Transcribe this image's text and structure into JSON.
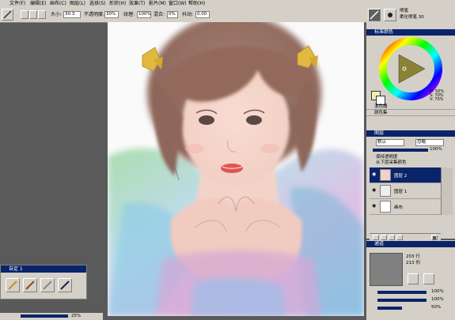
{
  "menu": [
    "文件(F)",
    "编辑(E)",
    "画布(C)",
    "图层(L)",
    "选择(S)",
    "形状(H)",
    "效果(T)",
    "影片(M)",
    "窗口(W)",
    "帮助(H)"
  ],
  "propbar": {
    "size_label": "大小:",
    "size_value": "30.3",
    "opacity_label": "不透明度:",
    "opacity_value": "30%",
    "grain_label": "纹理:",
    "grain_value": "100%",
    "blend_label": "混合:",
    "blend_value": "0%",
    "jitter_label": "抖动:",
    "jitter_value": "0.00"
  },
  "brush": {
    "category": "喷笔",
    "variant": "柔化喷笔 30"
  },
  "color_panel": {
    "title": "标准颜色",
    "readout": [
      "H: 50%",
      "S: 70%",
      "V: 70%"
    ],
    "accent": "#0a246a",
    "collapsed": [
      "混色器",
      "颜色集"
    ]
  },
  "layers_panel": {
    "title": "图层",
    "composite_method": "默认",
    "composite_depth": "忽略",
    "opacity_value": "100%",
    "options": [
      "保持透明度",
      "从下层采集颜色"
    ],
    "layers": [
      {
        "name": "图层 2",
        "selected": true
      },
      {
        "name": "图层 1",
        "selected": false
      },
      {
        "name": "画布",
        "selected": false
      }
    ]
  },
  "navigator": {
    "title": "通道",
    "readout": [
      "203 行",
      "213 列"
    ],
    "sliders": [
      "100%",
      "100%",
      "50%"
    ]
  },
  "custom_palette": {
    "title": "自定 1"
  },
  "status": {
    "zoom": "25%"
  }
}
